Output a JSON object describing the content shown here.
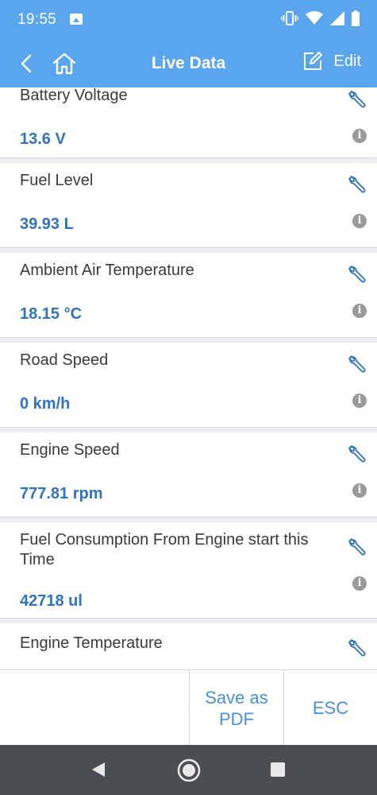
{
  "status": {
    "time": "19:55"
  },
  "appbar": {
    "title": "Live Data",
    "edit_label": "Edit"
  },
  "items": [
    {
      "name": "Battery Voltage",
      "value": "13.6 V"
    },
    {
      "name": "Fuel Level",
      "value": "39.93 L"
    },
    {
      "name": "Ambient Air Temperature",
      "value": "18.15 °C"
    },
    {
      "name": "Road Speed",
      "value": "0 km/h"
    },
    {
      "name": "Engine Speed",
      "value": "777.81 rpm"
    },
    {
      "name": "Fuel Consumption From Engine start this Time",
      "value": "42718 ul"
    },
    {
      "name": "Engine Temperature",
      "value": ""
    }
  ],
  "actions": {
    "save_pdf": "Save as PDF",
    "esc": "ESC"
  },
  "icons": {
    "wrench": "wrench-icon",
    "info": "info-icon",
    "back": "back-arrow-icon",
    "home": "home-icon",
    "edit": "edit-icon"
  },
  "colors": {
    "accent": "#5aa6ee",
    "value": "#2f72c1",
    "action": "#4a8fdc"
  }
}
